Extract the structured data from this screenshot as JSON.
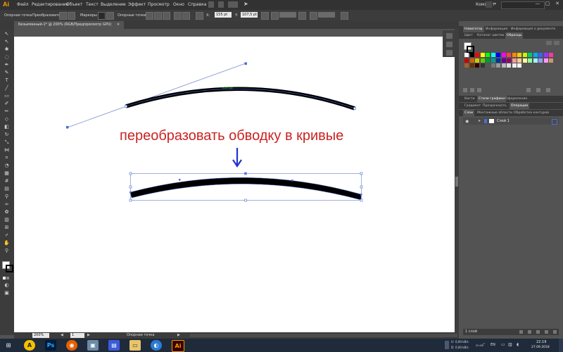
{
  "app": {
    "logo": "Ai"
  },
  "menu": [
    "Файл",
    "Редактирование",
    "Объект",
    "Текст",
    "Выделение",
    "Эффект",
    "Просмотр",
    "Окно",
    "Справка"
  ],
  "window": {
    "workspace": "Компакт",
    "minimize": "—",
    "maximize": "▢",
    "close": "✕"
  },
  "control_bar": {
    "anchor_label": "Опорная точка",
    "convert_label": "Преобразовать",
    "handles_label": "Маркеры",
    "anchor_points_label": "Опорные точки",
    "x_value": "155 pt",
    "y_value": "107,5 pt"
  },
  "document": {
    "tab_title": "Безымянный-1* @ 200% (RGB/Предпросмотр GPU)",
    "tab_close": "×"
  },
  "canvas": {
    "headline": "переобразовать обводку в кривые",
    "path_hint": "контур"
  },
  "panel": {
    "tabs_top": [
      "Навигатор",
      "Информация",
      "Информация о документе"
    ],
    "tabs_swatch": [
      "Цвет",
      "Каталог цветов",
      "Образцы"
    ],
    "tabs_mid": [
      "Кисти",
      "Стили графики",
      "Оформление"
    ],
    "tabs_mid2": [
      "Градиент",
      "Прозрачность",
      "Операции"
    ],
    "tabs_layers": [
      "Слои",
      "Монтажные области",
      "Обработка контуров"
    ],
    "layer_name": "Слой 1",
    "layers_count": "1 слой"
  },
  "status": {
    "zoom": "200%",
    "page": "1",
    "mode": "Опорная точка"
  },
  "taskbar": {
    "net_up": "0,00 kB/s",
    "net_down": "0,00 kB/s",
    "tray_label": "сн.оё",
    "lang": "EN",
    "time": "22:19",
    "date": "27.09.2018"
  },
  "colors": {
    "headline": "#cc2222",
    "arrow": "#2233cc",
    "selection": "#4a6fd9",
    "accent": "#ff9a00"
  },
  "swatch_colors": [
    "#ffffff",
    "#000000",
    "#ff0000",
    "#ffff00",
    "#00ff00",
    "#00ffff",
    "#0000ff",
    "#ff00ff",
    "#ff4040",
    "#ff8800",
    "#ffcc00",
    "#bbff00",
    "#00cc66",
    "#00aaff",
    "#3366ff",
    "#9933ff",
    "#ff33aa",
    "#cc0000",
    "#cc6600",
    "#cccc00",
    "#66cc00",
    "#009933",
    "#009999",
    "#003399",
    "#660099",
    "#990066",
    "#ff9999",
    "#ffcc99",
    "#ffff99",
    "#99ff99",
    "#99ffff",
    "#9999ff",
    "#ff99ff",
    "#cc9966",
    "#996633",
    "#663300",
    "#330000",
    "#333333",
    "#555555",
    "#777777",
    "#999999",
    "#bbbbbb",
    "#dddddd",
    "#eeeeee",
    "#f5f5f5"
  ]
}
